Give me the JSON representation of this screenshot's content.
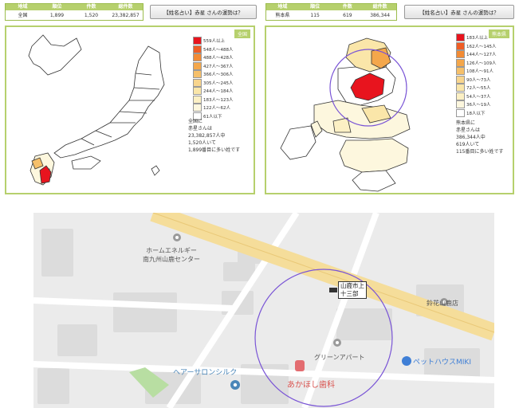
{
  "left_stats": {
    "headers": [
      "地域",
      "順位",
      "件数",
      "総件数"
    ],
    "values": [
      "全国",
      "1,899",
      "1,520",
      "23,382,857"
    ]
  },
  "left_fortune": "【姓名占い】赤星 さんの運勢は？",
  "right_stats": {
    "headers": [
      "地域",
      "順位",
      "件数",
      "総件数"
    ],
    "values": [
      "熊本県",
      "115",
      "619",
      "386,344"
    ]
  },
  "right_fortune": "【姓名占い】赤星 さんの運勢は？",
  "left_panel": {
    "tag": "全国",
    "legend": [
      {
        "label": "559人以上",
        "color": "#e8141e"
      },
      {
        "label": "548人〜488人",
        "color": "#ef5d25"
      },
      {
        "label": "488人〜428人",
        "color": "#f28b34"
      },
      {
        "label": "427人〜367人",
        "color": "#f4a74b"
      },
      {
        "label": "366人〜306人",
        "color": "#f6c06a"
      },
      {
        "label": "305人〜245人",
        "color": "#f8d58d"
      },
      {
        "label": "244人〜184人",
        "color": "#fae6a9"
      },
      {
        "label": "183人〜123人",
        "color": "#fcf0c4"
      },
      {
        "label": "122人〜62人",
        "color": "#fdf7de"
      },
      {
        "label": "61人以下",
        "color": "#ffffff"
      }
    ],
    "note": [
      "全国に",
      "赤星さんは",
      "23,382,857人中",
      "1,520人いて",
      "1,899番目に多い姓です"
    ]
  },
  "right_panel": {
    "tag": "熊本県",
    "legend": [
      {
        "label": "183人以上",
        "color": "#e8141e"
      },
      {
        "label": "162人〜145人",
        "color": "#ef5d25"
      },
      {
        "label": "144人〜127人",
        "color": "#f28b34"
      },
      {
        "label": "126人〜109人",
        "color": "#f4a74b"
      },
      {
        "label": "108人〜91人",
        "color": "#f6c06a"
      },
      {
        "label": "90人〜73人",
        "color": "#f8d58d"
      },
      {
        "label": "72人〜55人",
        "color": "#fae6a9"
      },
      {
        "label": "54人〜37人",
        "color": "#fcf0c4"
      },
      {
        "label": "36人〜19人",
        "color": "#fdf7de"
      },
      {
        "label": "18人以下",
        "color": "#ffffff"
      }
    ],
    "note": [
      "熊本県に",
      "赤星さんは",
      "386,344人中",
      "619人いて",
      "115番目に多い姓です"
    ]
  },
  "street_map": {
    "labels": {
      "home_energy_1": "ホームエネルギー",
      "home_energy_2": "南九州山鹿センター",
      "city_1": "山鹿市上",
      "city_2": "十三部",
      "suzuka": "鈴花山鹿店",
      "green": "グリーンアパート",
      "pet": "ペットハウスMIKI",
      "salon": "ヘアーサロンシルク",
      "dental": "あかほし歯科"
    },
    "colors": {
      "highlight": "#e8141e",
      "circle": "#7a55d6",
      "road": "#f5dd9a",
      "park": "#b8dea2"
    }
  }
}
